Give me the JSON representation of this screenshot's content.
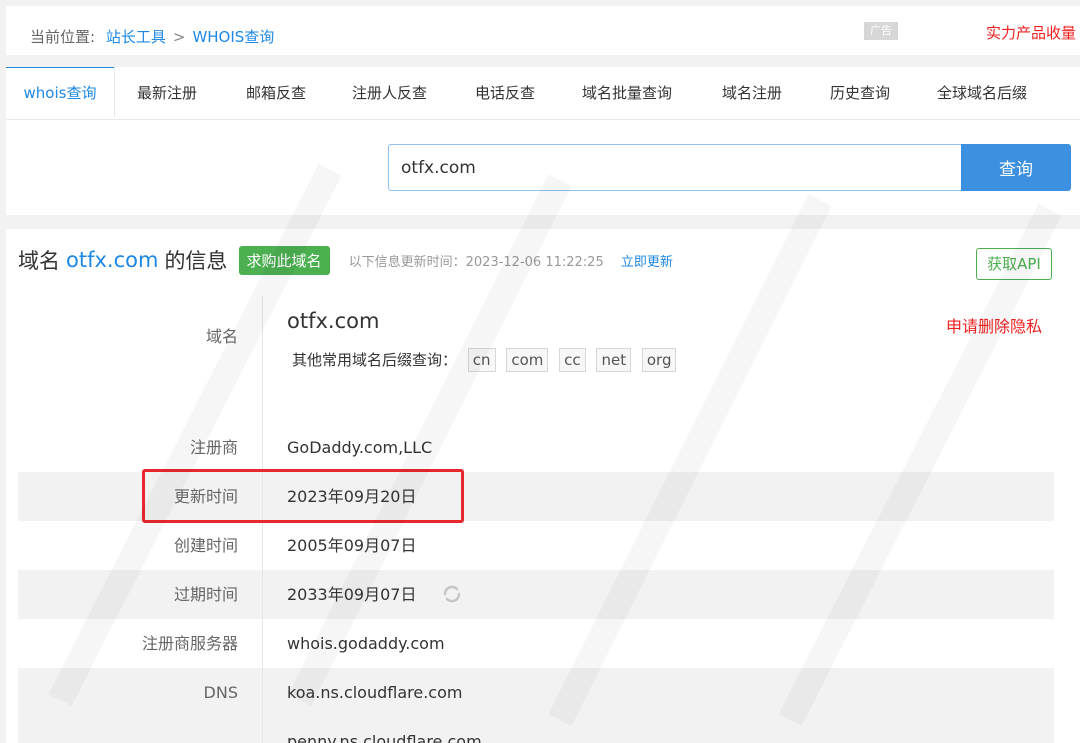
{
  "breadcrumb": {
    "current_label": "当前位置:",
    "link1": "站长工具",
    "sep": ">",
    "link2": "WHOIS查询"
  },
  "ad": {
    "badge": "广告",
    "text": "实力产品收量"
  },
  "tabs": [
    {
      "label": "whois查询",
      "active": true
    },
    {
      "label": "最新注册"
    },
    {
      "label": "邮箱反查"
    },
    {
      "label": "注册人反查"
    },
    {
      "label": "电话反查"
    },
    {
      "label": "域名批量查询"
    },
    {
      "label": "域名注册"
    },
    {
      "label": "历史查询"
    },
    {
      "label": "全球域名后缀"
    }
  ],
  "search": {
    "value": "otfx.com",
    "button": "查询"
  },
  "info": {
    "title_prefix": "域名",
    "title_domain": "otfx.com",
    "title_suffix": "的信息",
    "buy_label": "求购此域名",
    "update_label": "以下信息更新时间：2023-12-06 11:22:25",
    "update_link": "立即更新",
    "api_label": "获取API"
  },
  "rows": {
    "domain": {
      "label": "域名",
      "value": "otfx.com",
      "delete_privacy": "申请删除隐私",
      "suffix_label": "其他常用域名后缀查询：",
      "suffixes": [
        "cn",
        "com",
        "cc",
        "net",
        "org"
      ]
    },
    "registrar": {
      "label": "注册商",
      "value": "GoDaddy.com,LLC"
    },
    "updated": {
      "label": "更新时间",
      "value": "2023年09月20日"
    },
    "created": {
      "label": "创建时间",
      "value": "2005年09月07日"
    },
    "expires": {
      "label": "过期时间",
      "value": "2033年09月07日"
    },
    "whois_server": {
      "label": "注册商服务器",
      "value": "whois.godaddy.com"
    },
    "dns": {
      "label": "DNS",
      "values": [
        "koa.ns.cloudflare.com",
        "penny.ns.cloudflare.com"
      ]
    }
  },
  "colors": {
    "accent": "#1e88e5",
    "buy_green": "#4caf50",
    "highlight_red": "#e8262c",
    "privacy_red": "#f02020"
  }
}
